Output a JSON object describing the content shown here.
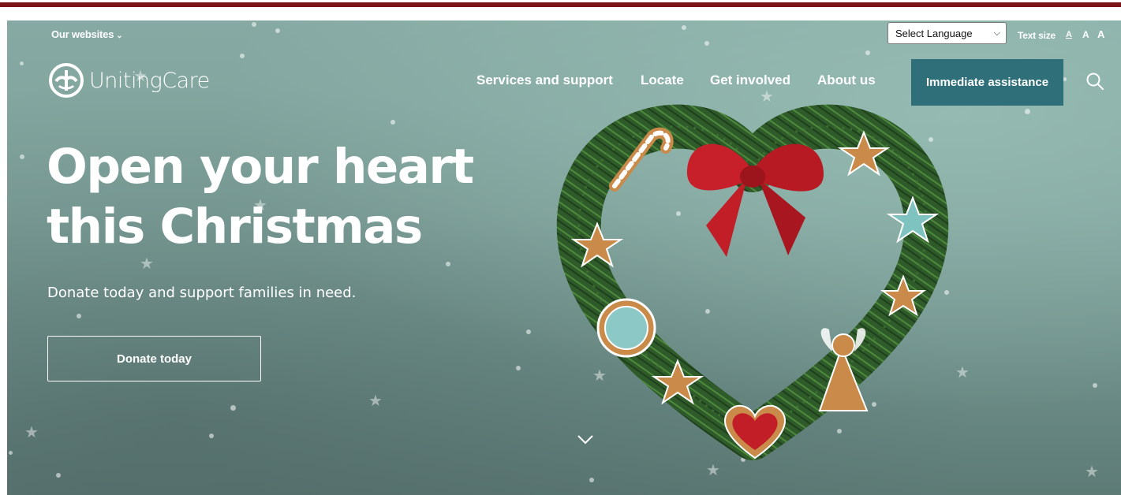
{
  "utility": {
    "our_websites": "Our websites",
    "language_select": "Select Language",
    "text_size_label": "Text size",
    "text_size_small": "A",
    "text_size_medium": "A",
    "text_size_large": "A"
  },
  "brand": {
    "name": "UnitingCare"
  },
  "nav": {
    "items": [
      {
        "label": "Services and support"
      },
      {
        "label": "Locate"
      },
      {
        "label": "Get involved"
      },
      {
        "label": "About us"
      }
    ],
    "cta": "Immediate assistance"
  },
  "hero": {
    "title_line1": "Open your heart",
    "title_line2": "this Christmas",
    "subtitle": "Donate today and support families in need.",
    "button": "Donate today"
  },
  "colors": {
    "top_border": "#7a1418",
    "cta_background": "#2f6f79",
    "hero_background": "#7fa29b"
  },
  "icons": {
    "dropdown": "chevron-down-icon",
    "search": "search-icon",
    "scroll": "chevron-down-icon"
  }
}
